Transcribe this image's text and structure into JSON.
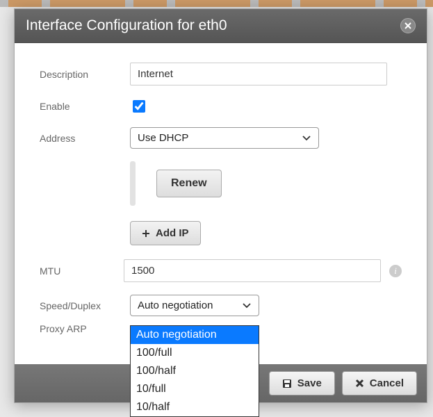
{
  "dialog": {
    "title": "Interface Configuration for eth0"
  },
  "form": {
    "description_label": "Description",
    "description_value": "Internet",
    "enable_label": "Enable",
    "enable_checked": true,
    "address_label": "Address",
    "address_value": "Use DHCP",
    "renew_label": "Renew",
    "addip_label": "Add IP",
    "mtu_label": "MTU",
    "mtu_value": "1500",
    "speed_label": "Speed/Duplex",
    "speed_value": "Auto negotiation",
    "speed_options": [
      "Auto negotiation",
      "100/full",
      "100/half",
      "10/full",
      "10/half"
    ],
    "proxyarp_label": "Proxy ARP"
  },
  "footer": {
    "save_label": "Save",
    "cancel_label": "Cancel"
  }
}
